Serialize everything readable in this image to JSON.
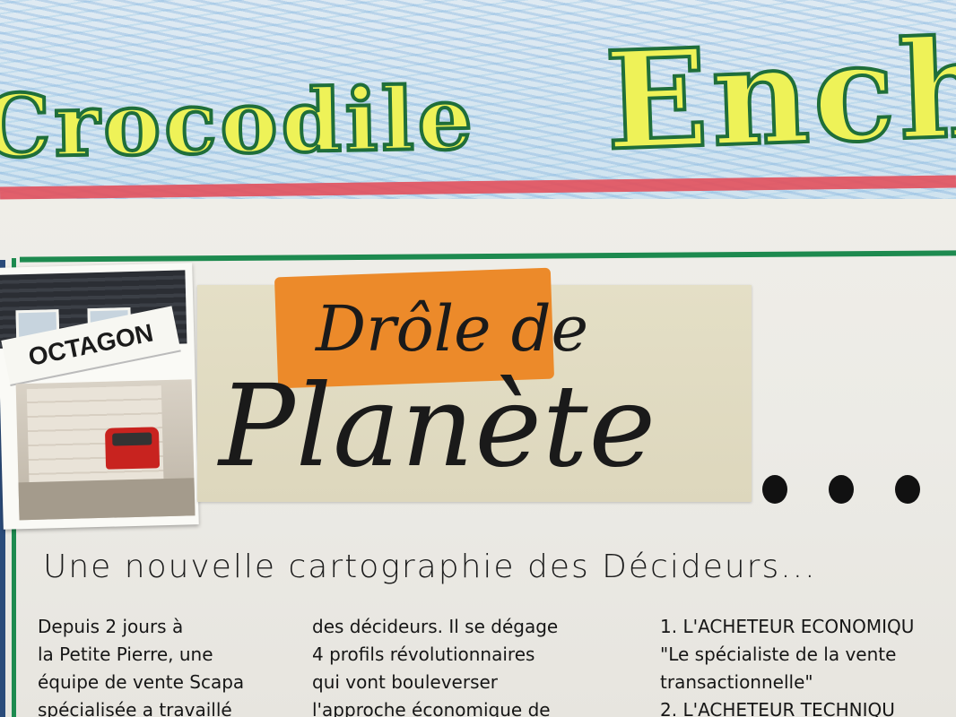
{
  "banner": {
    "word1": "Crocodile",
    "word2": "Ench"
  },
  "photo": {
    "sign_text": "OCTAGON"
  },
  "clipping": {
    "line1": "Drôle de",
    "line2": "Planète"
  },
  "ellipsis": "...",
  "notes": {
    "subtitle": "Une nouvelle cartographie des Décideurs...",
    "col1": [
      "Depuis 2 jours à",
      "la Petite Pierre, une",
      "équipe de vente Scapa",
      "spécialisée a travaillé"
    ],
    "col2": [
      "des décideurs. Il se dégage",
      "4 profils révolutionnaires",
      "qui vont bouleverser",
      "l'approche économique de"
    ],
    "col3": [
      "1. L'ACHETEUR ECONOMIQU",
      "\"Le spécialiste de la vente",
      "transactionnelle\"",
      "2. L'ACHETEUR TECHNIQU"
    ]
  },
  "colors": {
    "title_fill": "#eef258",
    "title_outline": "#1f6e3a",
    "red_rule": "#e2505c",
    "green_rule": "#1d8a4f",
    "orange_highlight": "#ec8a2a"
  }
}
